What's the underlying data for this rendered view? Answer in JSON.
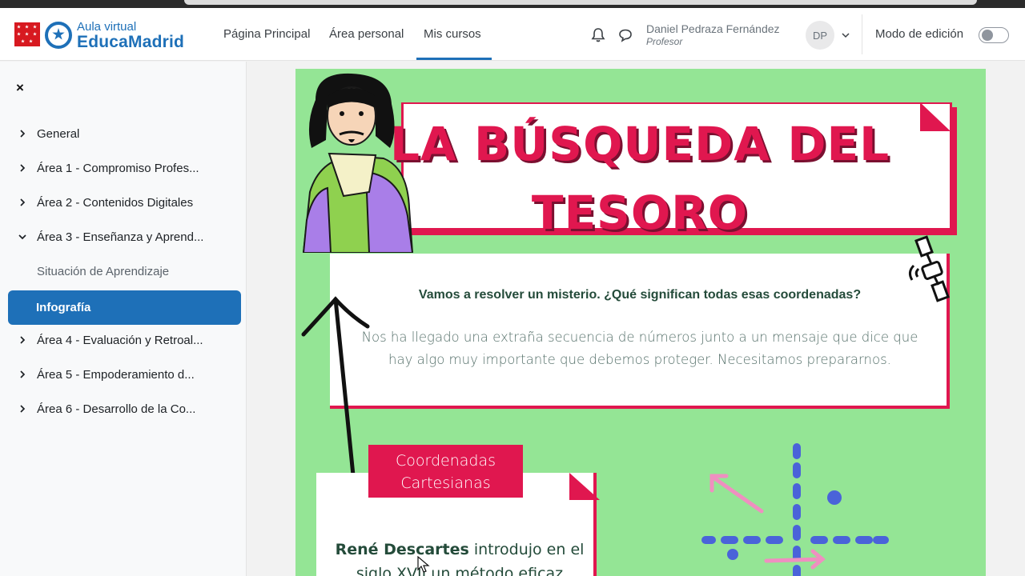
{
  "brand": {
    "subtitle": "Aula virtual",
    "name": "EducaMadrid",
    "flag_color": "#d71920",
    "accent": "#1e70b8"
  },
  "nav": {
    "links": [
      "Página Principal",
      "Área personal",
      "Mis cursos"
    ],
    "active": "Mis cursos"
  },
  "header": {
    "user_name": "Daniel Pedraza Fernández",
    "user_role": "Profesor",
    "avatar_initials": "DP",
    "edit_mode_label": "Modo de edición",
    "edit_mode_on": false,
    "icons": [
      "bell-icon",
      "chat-icon",
      "chevron-down-icon"
    ]
  },
  "sidebar": {
    "close_label": "×",
    "items": [
      {
        "label": "General",
        "expanded": false
      },
      {
        "label": "Área 1 - Compromiso Profes...",
        "expanded": false
      },
      {
        "label": "Área 2 - Contenidos Digitales",
        "expanded": false
      },
      {
        "label": "Área 3 - Enseñanza y Aprend...",
        "expanded": true
      },
      {
        "label": "Situación de Aprendizaje",
        "sub": true
      },
      {
        "label": "Infografía",
        "sub": true,
        "active": true
      },
      {
        "label": "Área 4 - Evaluación y Retroal...",
        "expanded": false
      },
      {
        "label": "Área 5 - Empoderamiento d...",
        "expanded": false
      },
      {
        "label": "Área 6 - Desarrollo de la Co...",
        "expanded": false
      }
    ]
  },
  "poster": {
    "bg_color": "#94e595",
    "accent_color": "#e0174f",
    "title_line1": "LA BÚSQUEDA DEL",
    "title_line2": "TESORO",
    "question": "Vamos a resolver un misterio. ¿Qué significan todas esas coordenadas?",
    "paragraph": "Nos ha llegado una extraña secuencia de números junto a un mensaje que dice que hay algo muy importante que debemos proteger. Necesitamos prepararnos.",
    "section_tag": "Coordenadas Cartesianas",
    "section_text_bold": "René Descartes",
    "section_text_rest": " introdujo en el siglo XVII un método eficaz"
  }
}
